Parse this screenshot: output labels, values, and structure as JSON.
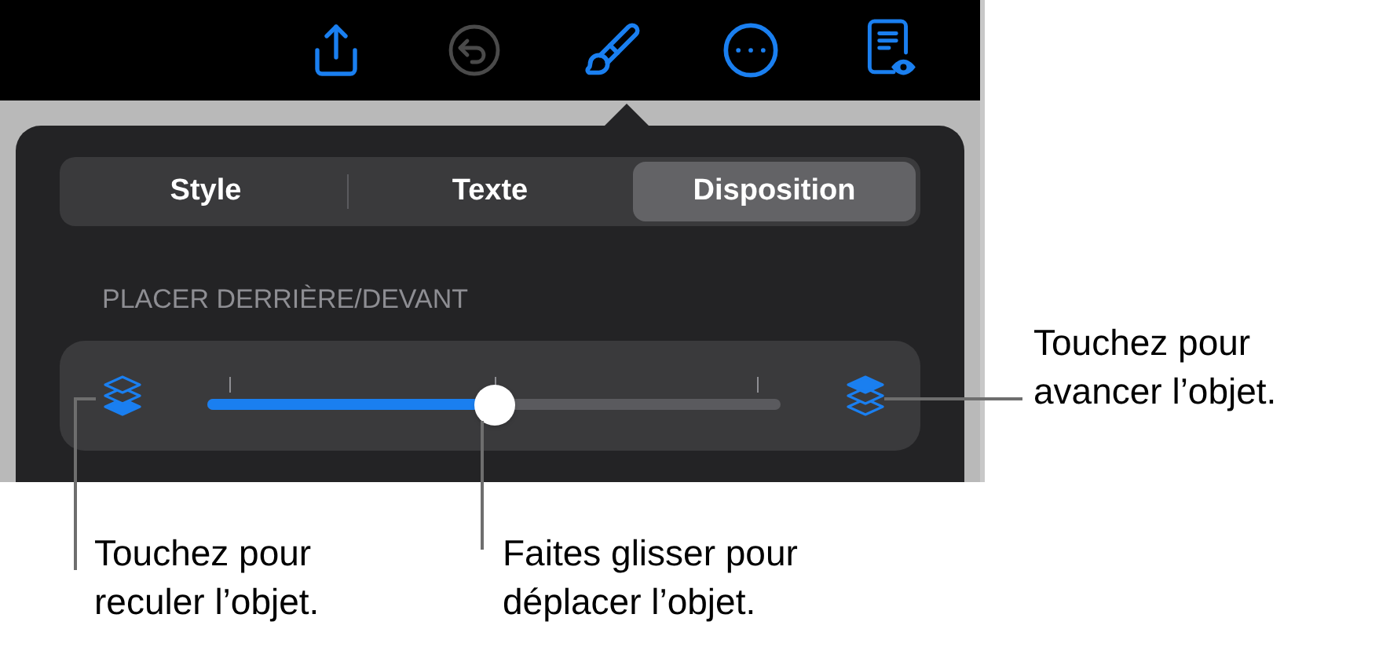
{
  "toolbar": [
    {
      "kind": "share",
      "disabled": false
    },
    {
      "kind": "undo",
      "disabled": true
    },
    {
      "kind": "brush",
      "disabled": false
    },
    {
      "kind": "more",
      "disabled": false
    },
    {
      "kind": "reader",
      "disabled": false
    }
  ],
  "tabs": [
    {
      "label": "Style",
      "selected": false
    },
    {
      "label": "Texte",
      "selected": false
    },
    {
      "label": "Disposition",
      "selected": true
    }
  ],
  "section_label": "PLACER DERRIÈRE/DEVANT",
  "slider": {
    "level": 0.5
  },
  "callouts": [
    {
      "kind": "left",
      "text": "Touchez pour\nreculer l’objet."
    },
    {
      "kind": "middle",
      "text": "Faites glisser pour\ndéplacer l’objet."
    },
    {
      "kind": "right",
      "text": "Touchez pour\navancer l’objet."
    }
  ]
}
